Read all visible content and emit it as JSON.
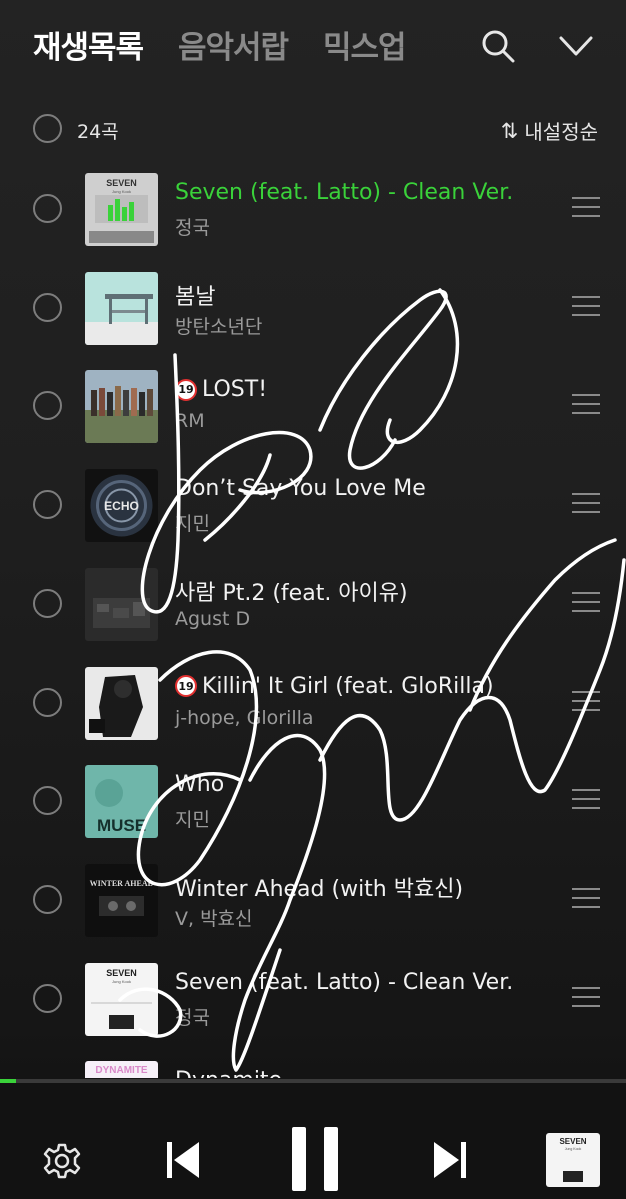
{
  "header": {
    "tabs": [
      {
        "label": "재생목록",
        "active": true
      },
      {
        "label": "음악서랍",
        "active": false
      },
      {
        "label": "믹스업",
        "active": false
      }
    ],
    "search_icon": "search-icon",
    "collapse_icon": "chevron-down-icon"
  },
  "playlist": {
    "count_label": "24곡",
    "sort_label": "내설정순",
    "sort_icon": "sort-arrows-icon",
    "tracks": [
      {
        "title": "Seven (feat. Latto) - Clean Ver.",
        "artist": "정국",
        "explicit": false,
        "playing": true
      },
      {
        "title": "봄날",
        "artist": "방탄소년단",
        "explicit": false,
        "playing": false
      },
      {
        "title": "LOST!",
        "artist": "RM",
        "explicit": true,
        "playing": false
      },
      {
        "title": "Don’t Say You Love Me",
        "artist": "지민",
        "explicit": false,
        "playing": false
      },
      {
        "title": "사람 Pt.2 (feat. 아이유)",
        "artist": "Agust D",
        "explicit": false,
        "playing": false
      },
      {
        "title": "Killin' It Girl (feat. GloRilla)",
        "artist": "j-hope, Glorilla",
        "explicit": true,
        "playing": false
      },
      {
        "title": "Who",
        "artist": "지민",
        "explicit": false,
        "playing": false
      },
      {
        "title": "Winter Ahead (with 박효신)",
        "artist": "V, 박효신",
        "explicit": false,
        "playing": false
      },
      {
        "title": "Seven (feat. Latto) - Clean Ver.",
        "artist": "정국",
        "explicit": false,
        "playing": false
      },
      {
        "title": "Dynamite",
        "artist": "",
        "explicit": false,
        "playing": false
      }
    ],
    "explicit_badge": "19"
  },
  "player": {
    "progress": 0.025,
    "settings_icon": "gear-icon",
    "prev_icon": "skip-previous-icon",
    "pause_icon": "pause-icon",
    "next_icon": "skip-next-icon",
    "now_playing_art": {
      "title": "SEVEN",
      "subtitle": "Jung Kook"
    }
  },
  "art_text": {
    "seven_title": "SEVEN",
    "seven_sub": "Jung Kook",
    "echo": "ECHO",
    "muse": "MUSE",
    "winter": "WINTER AHEAD",
    "dynamite": "DYNAMITE"
  },
  "colors": {
    "accent": "#3ad23a",
    "background": "#1f1f1f",
    "explicit_ring": "#e23030"
  }
}
